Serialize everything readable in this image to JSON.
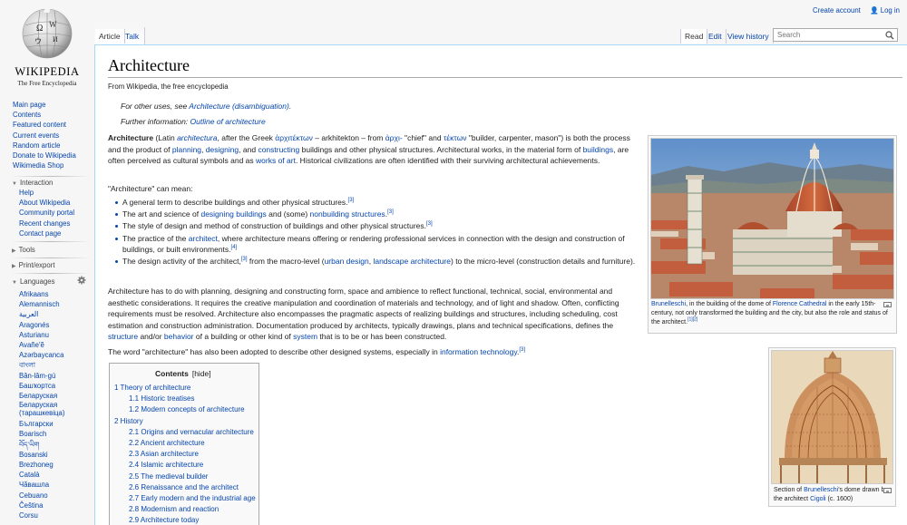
{
  "logo": {
    "wordmark": "WIKIPEDIA",
    "tagline": "The Free Encyclopedia"
  },
  "personal": {
    "create_account": "Create account",
    "login": "Log in"
  },
  "tabs": {
    "article": "Article",
    "talk": "Talk",
    "read": "Read",
    "edit": "Edit",
    "history": "View history"
  },
  "search": {
    "placeholder": "Search"
  },
  "nav": {
    "main": [
      "Main page",
      "Contents",
      "Featured content",
      "Current events",
      "Random article",
      "Donate to Wikipedia",
      "Wikimedia Shop"
    ],
    "interaction_header": "Interaction",
    "interaction": [
      "Help",
      "About Wikipedia",
      "Community portal",
      "Recent changes",
      "Contact page"
    ],
    "tools_header": "Tools",
    "print_header": "Print/export",
    "languages_header": "Languages",
    "languages": [
      "Afrikaans",
      "Alemannisch",
      "العربية",
      "Aragonés",
      "Asturianu",
      "Avañe'ẽ",
      "Azərbaycanca",
      "বাংলা",
      "Bân-lâm-gú",
      "Башҡортса",
      "Беларуская",
      "Беларуская (тарашкевіца)",
      "Български",
      "Boarisch",
      "བོད་ཡིག",
      "Bosanski",
      "Brezhoneg",
      "Català",
      "Чӑвашла",
      "Cebuano",
      "Čeština",
      "Corsu"
    ]
  },
  "article": {
    "title": "Architecture",
    "site_sub": "From Wikipedia, the free encyclopedia",
    "hatnote1_prefix": "For other uses, see ",
    "hatnote1_link": "Architecture (disambiguation)",
    "hatnote1_suffix": ".",
    "hatnote2_prefix": "Further information: ",
    "hatnote2_link": "Outline of architecture",
    "intro": {
      "bold": "Architecture",
      "t1": " (Latin ",
      "l1": "architectura",
      "t2": ", after the Greek ",
      "l2": "ἀρχιτέκτων",
      "t3": " – arkhitekton – from ",
      "l3": "ἀρχι-",
      "t4": " \"chief\" and ",
      "l4": "τέκτων",
      "t5": " \"builder, carpenter, mason\") is both the process and the product of ",
      "l5": "planning",
      "t6": ", ",
      "l6": "designing",
      "t7": ", and ",
      "l7": "constructing",
      "t8": " buildings and other physical structures. Architectural works, in the material form of ",
      "l8": "buildings",
      "t9": ", are often perceived as cultural symbols and as ",
      "l9": "works of art",
      "t10": ". Historical civilizations are often identified with their surviving architectural achievements."
    },
    "can_mean": "\"Architecture\" can mean:",
    "bullets": {
      "b1": "A general term to describe buildings and other physical structures.",
      "ref3": "[3]",
      "b2a": "The art and science of ",
      "b2l1": "designing",
      "b2l2": "buildings",
      "b2b": " and (some) ",
      "b2l3": "nonbuilding structures",
      "b2c": ".",
      "b3": "The style of design and method of construction of buildings and other physical structures.",
      "b4a": "The practice of the ",
      "b4l": "architect",
      "b4b": ", where architecture means offering or rendering professional services in connection with the design and construction of buildings, or built environments.",
      "ref4": "[4]",
      "b5a": "The design activity of the architect,",
      "b5b": " from the macro-level (",
      "b5l1": "urban design",
      "b5c": ", ",
      "b5l2": "landscape architecture",
      "b5d": ") to the micro-level (construction details and furniture)."
    },
    "para2": {
      "t1": "Architecture has to do with planning, designing and constructing form, space and ambience to reflect functional, technical, social, environmental and aesthetic considerations. It requires the creative manipulation and coordination of materials and technology, and of light and shadow. Often, conflicting requirements must be resolved. Architecture also encompasses the pragmatic aspects of realizing buildings and structures, including scheduling, cost estimation and construction administration. Documentation produced by architects, typically drawings, plans and technical specifications, defines the ",
      "l1": "structure",
      "t2": " and/or ",
      "l2": "behavior",
      "t3": " of a building or other kind of ",
      "l3": "system",
      "t4": " that is to be or has been constructed."
    },
    "para3": {
      "t1": "The word \"architecture\" has also been adopted to describe other designed systems, especially in ",
      "l1": "information technology",
      "t2": "."
    }
  },
  "toc": {
    "title": "Contents",
    "hide": "[hide]",
    "items": [
      {
        "text": "1 Theory of architecture",
        "level": 1
      },
      {
        "text": "1.1 Historic treatises",
        "level": 2
      },
      {
        "text": "1.2 Modern concepts of architecture",
        "level": 2
      },
      {
        "text": "2 History",
        "level": 1
      },
      {
        "text": "2.1 Origins and vernacular architecture",
        "level": 2
      },
      {
        "text": "2.2 Ancient architecture",
        "level": 2
      },
      {
        "text": "2.3 Asian architecture",
        "level": 2
      },
      {
        "text": "2.4 Islamic architecture",
        "level": 2
      },
      {
        "text": "2.5 The medieval builder",
        "level": 2
      },
      {
        "text": "2.6 Renaissance and the architect",
        "level": 2
      },
      {
        "text": "2.7 Early modern and the industrial age",
        "level": 2
      },
      {
        "text": "2.8 Modernism and reaction",
        "level": 2
      },
      {
        "text": "2.9 Architecture today",
        "level": 2
      }
    ]
  },
  "thumb1": {
    "l1": "Brunelleschi",
    "t1": ", in the building of the dome of ",
    "l2": "Florence Cathedral",
    "t2": " in the early 15th-century, not only transformed the building and the city, but also the role and status of the architect.",
    "refs": "[1][2]"
  },
  "thumb2": {
    "t1": "Section of ",
    "l1": "Brunelleschi",
    "t2": "'s dome drawn by the architect ",
    "l2": "Cigoli",
    "t3": " (c. 1600)"
  },
  "colors": {
    "link": "#0645ad",
    "border": "#a7d7f9",
    "sidebar_bg": "#f6f6f6"
  }
}
